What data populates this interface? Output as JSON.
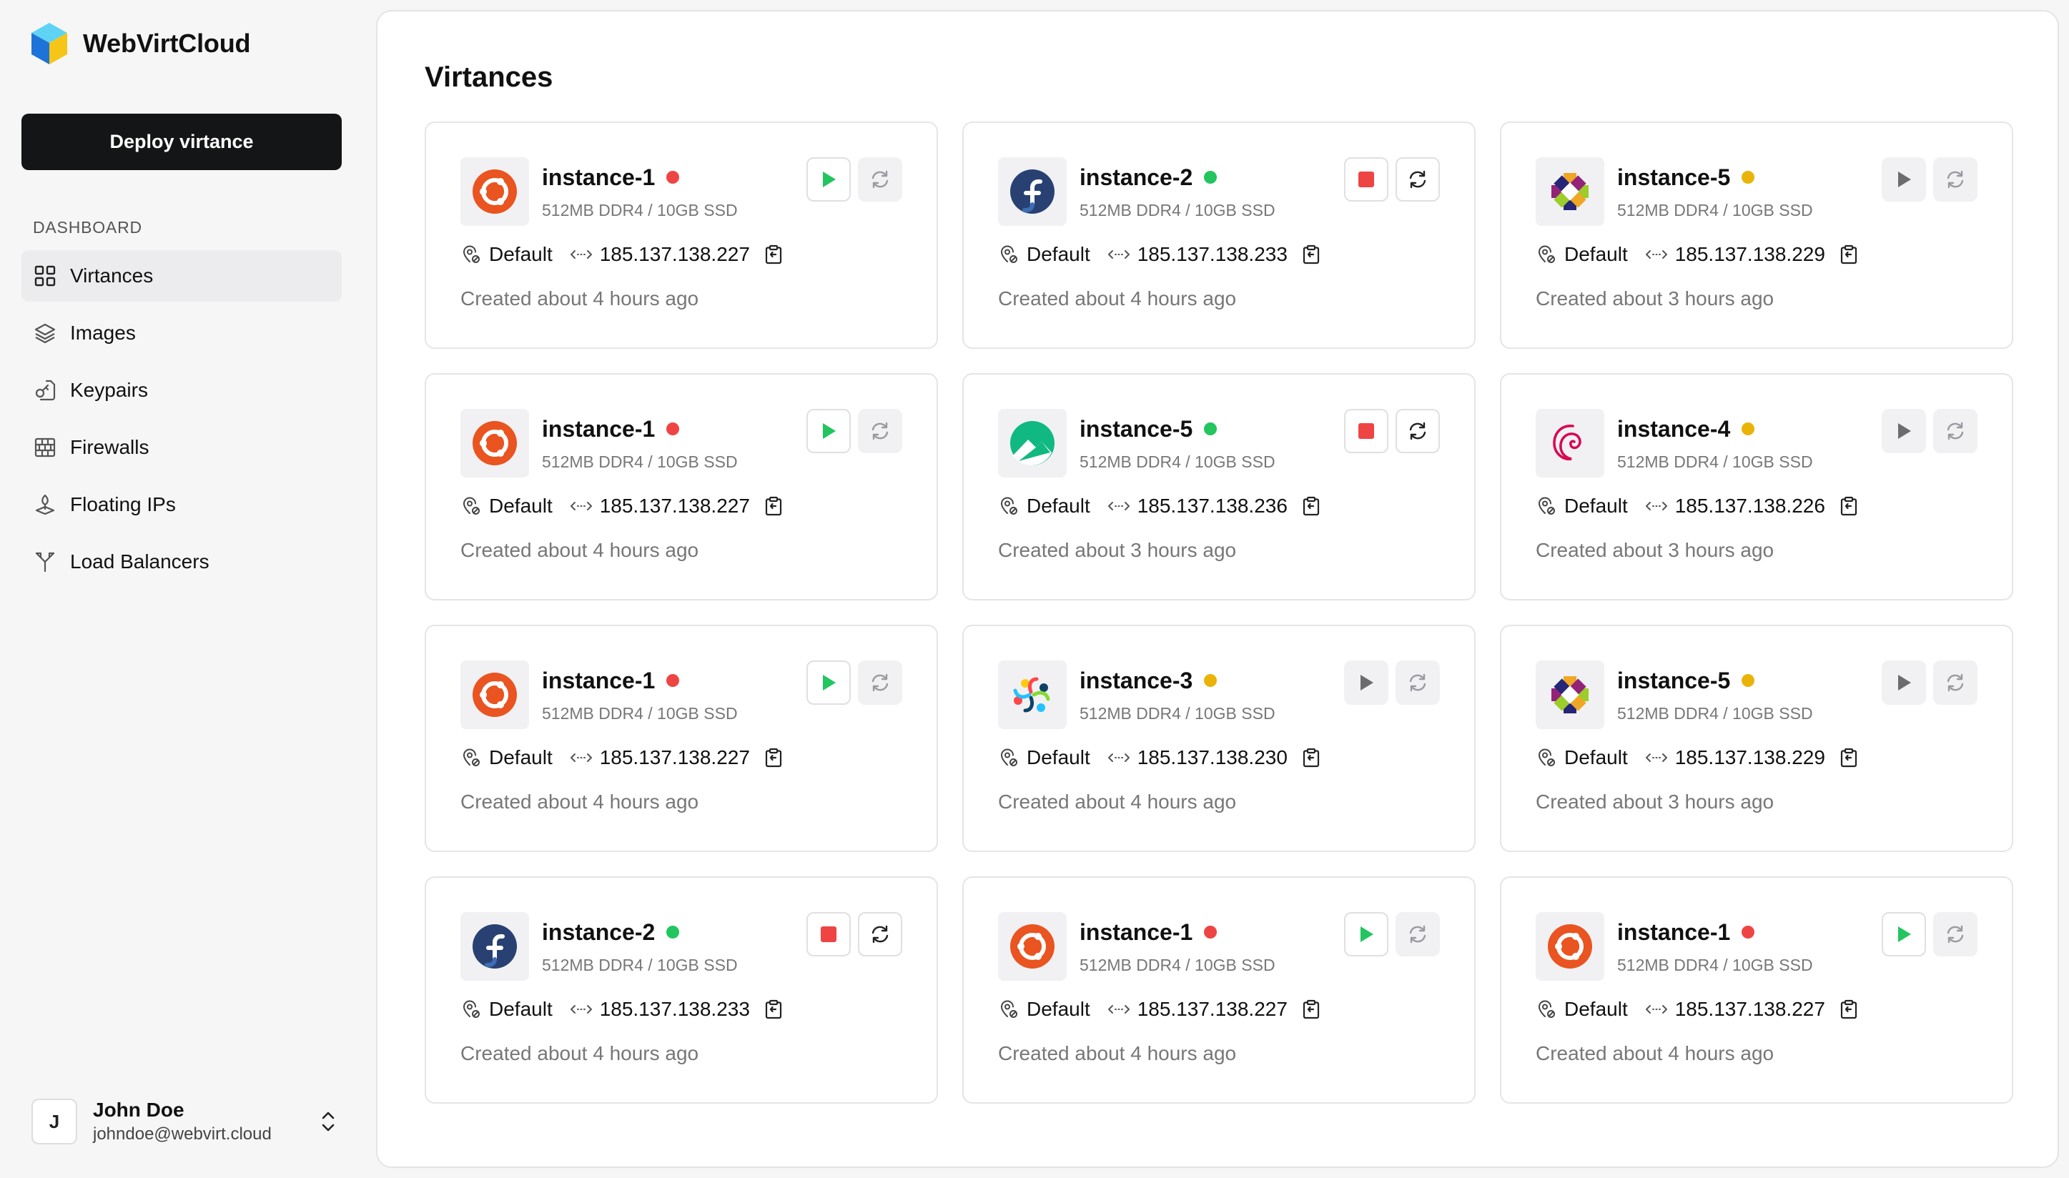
{
  "app": {
    "name": "WebVirtCloud"
  },
  "sidebar": {
    "deploy_label": "Deploy virtance",
    "section_label": "DASHBOARD",
    "items": [
      {
        "label": "Virtances",
        "icon": "grid-icon",
        "active": true
      },
      {
        "label": "Images",
        "icon": "layers-icon",
        "active": false
      },
      {
        "label": "Keypairs",
        "icon": "key-icon",
        "active": false
      },
      {
        "label": "Firewalls",
        "icon": "brick-wall-icon",
        "active": false
      },
      {
        "label": "Floating IPs",
        "icon": "floating-ip-icon",
        "active": false
      },
      {
        "label": "Load Balancers",
        "icon": "split-icon",
        "active": false
      }
    ]
  },
  "user": {
    "initial": "J",
    "name": "John Doe",
    "email": "johndoe@webvirt.cloud"
  },
  "main": {
    "title": "Virtances",
    "cards": [
      {
        "name": "instance-1",
        "os": "ubuntu",
        "status": "red",
        "spec": "512MB DDR4 / 10GB SSD",
        "region": "Default",
        "ip": "185.137.138.227",
        "created": "Created about 4 hours ago",
        "primary": "start"
      },
      {
        "name": "instance-2",
        "os": "fedora",
        "status": "green",
        "spec": "512MB DDR4 / 10GB SSD",
        "region": "Default",
        "ip": "185.137.138.233",
        "created": "Created about 4 hours ago",
        "primary": "stop"
      },
      {
        "name": "instance-5",
        "os": "centos",
        "status": "amber",
        "spec": "512MB DDR4 / 10GB SSD",
        "region": "Default",
        "ip": "185.137.138.229",
        "created": "Created about 3 hours ago",
        "primary": "pending"
      },
      {
        "name": "instance-1",
        "os": "ubuntu",
        "status": "red",
        "spec": "512MB DDR4 / 10GB SSD",
        "region": "Default",
        "ip": "185.137.138.227",
        "created": "Created about 4 hours ago",
        "primary": "start"
      },
      {
        "name": "instance-5",
        "os": "rocky",
        "status": "green",
        "spec": "512MB DDR4 / 10GB SSD",
        "region": "Default",
        "ip": "185.137.138.236",
        "created": "Created about 3 hours ago",
        "primary": "stop"
      },
      {
        "name": "instance-4",
        "os": "debian",
        "status": "amber",
        "spec": "512MB DDR4 / 10GB SSD",
        "region": "Default",
        "ip": "185.137.138.226",
        "created": "Created about 3 hours ago",
        "primary": "pending"
      },
      {
        "name": "instance-1",
        "os": "ubuntu",
        "status": "red",
        "spec": "512MB DDR4 / 10GB SSD",
        "region": "Default",
        "ip": "185.137.138.227",
        "created": "Created about 4 hours ago",
        "primary": "start"
      },
      {
        "name": "instance-3",
        "os": "almalinux",
        "status": "amber",
        "spec": "512MB DDR4 / 10GB SSD",
        "region": "Default",
        "ip": "185.137.138.230",
        "created": "Created about 4 hours ago",
        "primary": "pending"
      },
      {
        "name": "instance-5",
        "os": "centos",
        "status": "amber",
        "spec": "512MB DDR4 / 10GB SSD",
        "region": "Default",
        "ip": "185.137.138.229",
        "created": "Created about 3 hours ago",
        "primary": "pending"
      },
      {
        "name": "instance-2",
        "os": "fedora",
        "status": "green",
        "spec": "512MB DDR4 / 10GB SSD",
        "region": "Default",
        "ip": "185.137.138.233",
        "created": "Created about 4 hours ago",
        "primary": "stop"
      },
      {
        "name": "instance-1",
        "os": "ubuntu",
        "status": "red",
        "spec": "512MB DDR4 / 10GB SSD",
        "region": "Default",
        "ip": "185.137.138.227",
        "created": "Created about 4 hours ago",
        "primary": "start"
      },
      {
        "name": "instance-1",
        "os": "ubuntu",
        "status": "red",
        "spec": "512MB DDR4 / 10GB SSD",
        "region": "Default",
        "ip": "185.137.138.227",
        "created": "Created about 4 hours ago",
        "primary": "start"
      }
    ]
  },
  "colors": {
    "status_red": "#ef4444",
    "status_green": "#22c55e",
    "status_amber": "#eab308",
    "play_green": "#22c55e",
    "stop_red": "#ef4444",
    "deploy_bg": "#131517"
  }
}
